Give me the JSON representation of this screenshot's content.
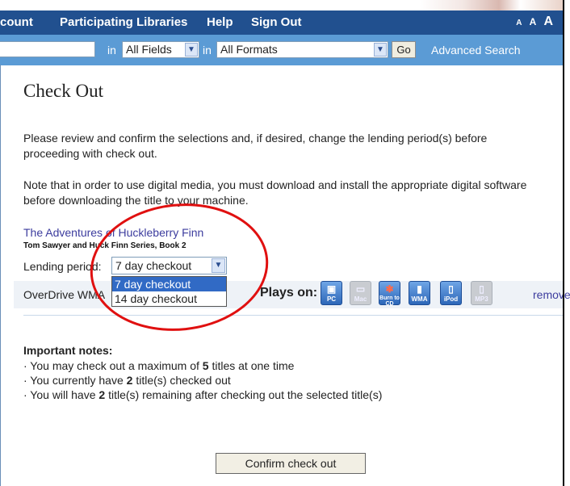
{
  "nav": {
    "items": [
      "count",
      "Participating Libraries",
      "Help",
      "Sign Out"
    ],
    "font_sizes": [
      "A",
      "A",
      "A"
    ]
  },
  "search": {
    "input_value": "",
    "in1": "in",
    "fields_value": "All Fields",
    "in2": "in",
    "formats_value": "All Formats",
    "go_label": "Go",
    "advanced_label": "Advanced Search"
  },
  "main": {
    "title": "Check Out",
    "para1": "Please review and confirm the selections and, if desired, change the lending period(s) before proceeding with check out.",
    "para2": "Note that in order to use digital media, you must download and install the appropriate digital software before downloading the title to your machine.",
    "book_title": "The Adventures of Huckleberry Finn",
    "series": "Tom Sawyer and Huck Finn Series, Book 2",
    "lending_label": "Lending period:",
    "lending_value": "7 day checkout",
    "lending_options": [
      "7 day checkout",
      "14 day checkout"
    ],
    "format": "OverDrive WMA",
    "plays_on": "Plays on:",
    "devices": [
      {
        "label": "PC",
        "icon": "pc-icon",
        "enabled": true
      },
      {
        "label": "Mac",
        "icon": "mac-icon",
        "enabled": false
      },
      {
        "label": "Burn to CD",
        "icon": "burn-cd-icon",
        "enabled": true
      },
      {
        "label": "WMA",
        "icon": "wma-player-icon",
        "enabled": true
      },
      {
        "label": "iPod",
        "icon": "ipod-icon",
        "enabled": true
      },
      {
        "label": "MP3",
        "icon": "mp3-player-icon",
        "enabled": false
      }
    ],
    "remove_label": "remove"
  },
  "notes": {
    "title": "Important notes:",
    "line1_pre": "· You may check out a maximum of ",
    "max_titles": "5",
    "line1_post": " titles at one time",
    "line2_pre": "· You currently have ",
    "current_titles": "2",
    "line2_post": " title(s) checked out",
    "line3_pre": "· You will have ",
    "remaining_titles": "2",
    "line3_post": " title(s) remaining after checking out the selected title(s)"
  },
  "confirm_label": "Confirm check out",
  "colors": {
    "nav_bg": "#21508f",
    "search_bg": "#5b9bd5",
    "link": "#3c3c9e",
    "annotation": "#e01010"
  }
}
